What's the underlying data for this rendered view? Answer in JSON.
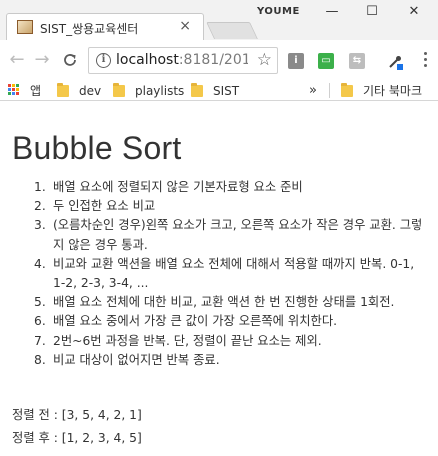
{
  "browser": {
    "tab": {
      "title": "SIST_쌍용교육센터",
      "close": "×"
    },
    "profile_name": "YOUME",
    "window_buttons": {
      "minimize": "—",
      "maximize": "☐",
      "close": "✕"
    },
    "nav": {
      "back": "←",
      "forward": "→",
      "reload": "C"
    },
    "address": {
      "host": "localhost",
      "rest": ":8181/201..."
    },
    "bookmarks": [
      {
        "label": "앱",
        "icon": "apps-icon"
      },
      {
        "label": "dev",
        "icon": "folder-icon"
      },
      {
        "label": "playlists",
        "icon": "folder-icon"
      },
      {
        "label": "SIST",
        "icon": "folder-icon"
      }
    ],
    "bookmarks_overflow": "»",
    "other_bookmarks": "기타 북마크"
  },
  "page": {
    "title": "Bubble Sort",
    "steps": [
      {
        "num": "1.",
        "text": "배열 요소에 정렬되지 않은 기본자료형 요소 준비"
      },
      {
        "num": "2.",
        "text": "두 인접한 요소 비교"
      },
      {
        "num": "3.",
        "text": "(오름차순인 경우)왼쪽 요소가 크고, 오른쪽 요소가 작은 경우 교환. 그렇지 않은 경우 통과."
      },
      {
        "num": "4.",
        "text": "비교와 교환 액션을 배열 요소 전체에 대해서 적용할 때까지 반복. 0-1, 1-2, 2-3, 3-4, ..."
      },
      {
        "num": "5.",
        "text": "배열 요소 전체에 대한 비교, 교환 액션 한 번 진행한 상태를 1회전."
      },
      {
        "num": "6.",
        "text": "배열 요소 중에서 가장 큰 값이 가장 오른쪽에 위치한다."
      },
      {
        "num": "7.",
        "text": "2번~6번 과정을 반복. 단, 정렬이 끝난 요소는 제외."
      },
      {
        "num": "8.",
        "text": "비교 대상이 없어지면 반복 종료."
      }
    ],
    "before": "정렬 전 : [3, 5, 4, 2, 1]",
    "after": "정렬 후 : [1, 2, 3, 4, 5]"
  }
}
